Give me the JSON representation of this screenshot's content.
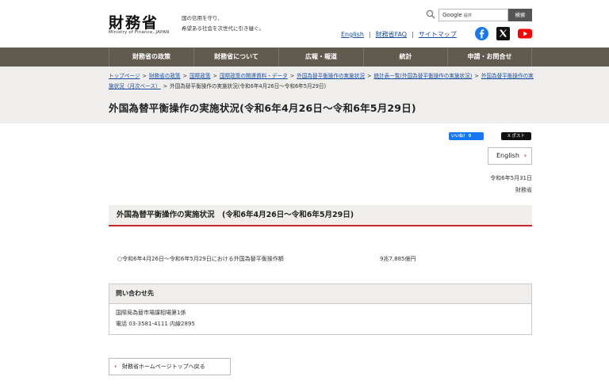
{
  "header": {
    "logo_main": "財務省",
    "logo_sub": "Ministry of Finance, JAPAN",
    "tagline_line1": "国の信用を守り、",
    "tagline_line2": "希望ある社会を次世代に引き継ぐ。",
    "search": {
      "placeholder": "Google",
      "placeholder_small": "提供",
      "button_label": "検索",
      "icon": "search-icon"
    },
    "util_links": {
      "english": "English",
      "faq": "財務省FAQ",
      "sitemap": "サイトマップ",
      "separator": "|"
    },
    "social": {
      "facebook_icon": "facebook-icon",
      "x_icon": "x-icon",
      "youtube_icon": "youtube-icon",
      "facebook_color": "#1877f2",
      "youtube_color": "#ff0000"
    }
  },
  "global_nav": {
    "items": [
      {
        "label": "財務省の政策"
      },
      {
        "label": "財務省について"
      },
      {
        "label": "広報・報道"
      },
      {
        "label": "統計"
      },
      {
        "label": "申請・お問合せ"
      }
    ],
    "background": "#615a4f"
  },
  "breadcrumb": {
    "items": [
      "トップページ",
      "財務省の政策",
      "国際政策",
      "国際政策の関連資料・データ",
      "外国為替平衡操作の実施状況",
      "統計表一覧(外国為替平衡操作の実施状況)",
      "外国為替平衡操作の実施状況（月次ベース）"
    ],
    "current": "外国為替平衡操作の実施状況(令和6年4月26日～令和6年5月29日)",
    "separator": ">"
  },
  "page": {
    "title": "外国為替平衡操作の実施状況(令和6年4月26日～令和6年5月29日)",
    "fb_like_label": "いいね！ 0",
    "x_post_label": "X ポスト",
    "english_button": "English",
    "date": "令和6年5月31日",
    "organization": "財務省",
    "accent_color": "#c62828"
  },
  "section": {
    "heading": "外国為替平衡操作の実施状況　(令和6年4月26日～令和6年5月29日)",
    "row_label": "○令和6年4月26日～令和6年5月29日における外国為替平衡操作額",
    "row_value": "9兆7,885億円"
  },
  "contact": {
    "heading": "問い合わせ先",
    "department": "国際局為替市場課相場第1係",
    "phone": "電話 03-3581-4111 内線2895"
  },
  "footer": {
    "back_button": "財務省ホームページトップへ戻る"
  }
}
